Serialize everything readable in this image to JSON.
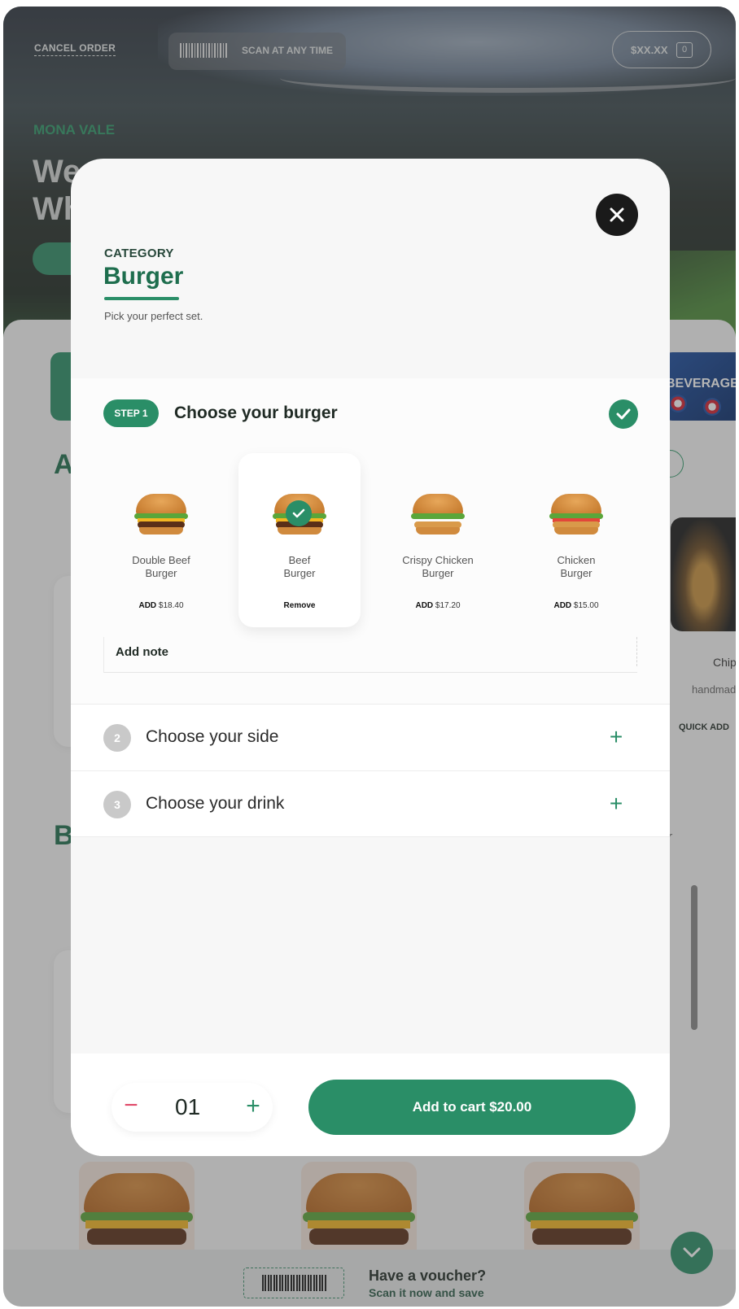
{
  "background": {
    "cancel_order": "CANCEL ORDER",
    "scan_label": "SCAN AT ANY TIME",
    "cart_price": "$XX.XX",
    "cart_count": "0",
    "venue": "MONA VALE",
    "welcome_partial": "We\nWh",
    "beverage_label": "BEVERAGE",
    "section_a_initial": "A",
    "section_b_initial": "B",
    "chips_name": "Chip",
    "chips_desc": "handmad",
    "quick_add": "QUICK ADD",
    "order_note_partial": "der",
    "voucher_title": "Have a voucher?",
    "voucher_sub": "Scan it now and save"
  },
  "modal": {
    "category_label": "CATEGORY",
    "category_title": "Burger",
    "category_sub": "Pick your perfect set.",
    "step1": {
      "badge": "STEP 1",
      "title": "Choose your burger",
      "options": [
        {
          "name_line1": "Double Beef",
          "name_line2": "Burger",
          "add_label": "ADD",
          "price": "$18.40",
          "selected": false
        },
        {
          "name_line1": "Beef",
          "name_line2": "Burger",
          "action": "Remove",
          "selected": true
        },
        {
          "name_line1": "Crispy Chicken",
          "name_line2": "Burger",
          "add_label": "ADD",
          "price": "$17.20",
          "selected": false
        },
        {
          "name_line1": "Chicken",
          "name_line2": "Burger",
          "add_label": "ADD",
          "price": "$15.00",
          "selected": false
        }
      ]
    },
    "note_label": "Add note",
    "step2": {
      "num": "2",
      "title": "Choose your side"
    },
    "step3": {
      "num": "3",
      "title": "Choose your drink"
    },
    "quantity": "01",
    "add_to_cart": "Add to cart $20.00"
  },
  "colors": {
    "brand_green": "#2a8e67",
    "dark_green": "#1e6e4e",
    "minus_pink": "#e04a6a"
  }
}
